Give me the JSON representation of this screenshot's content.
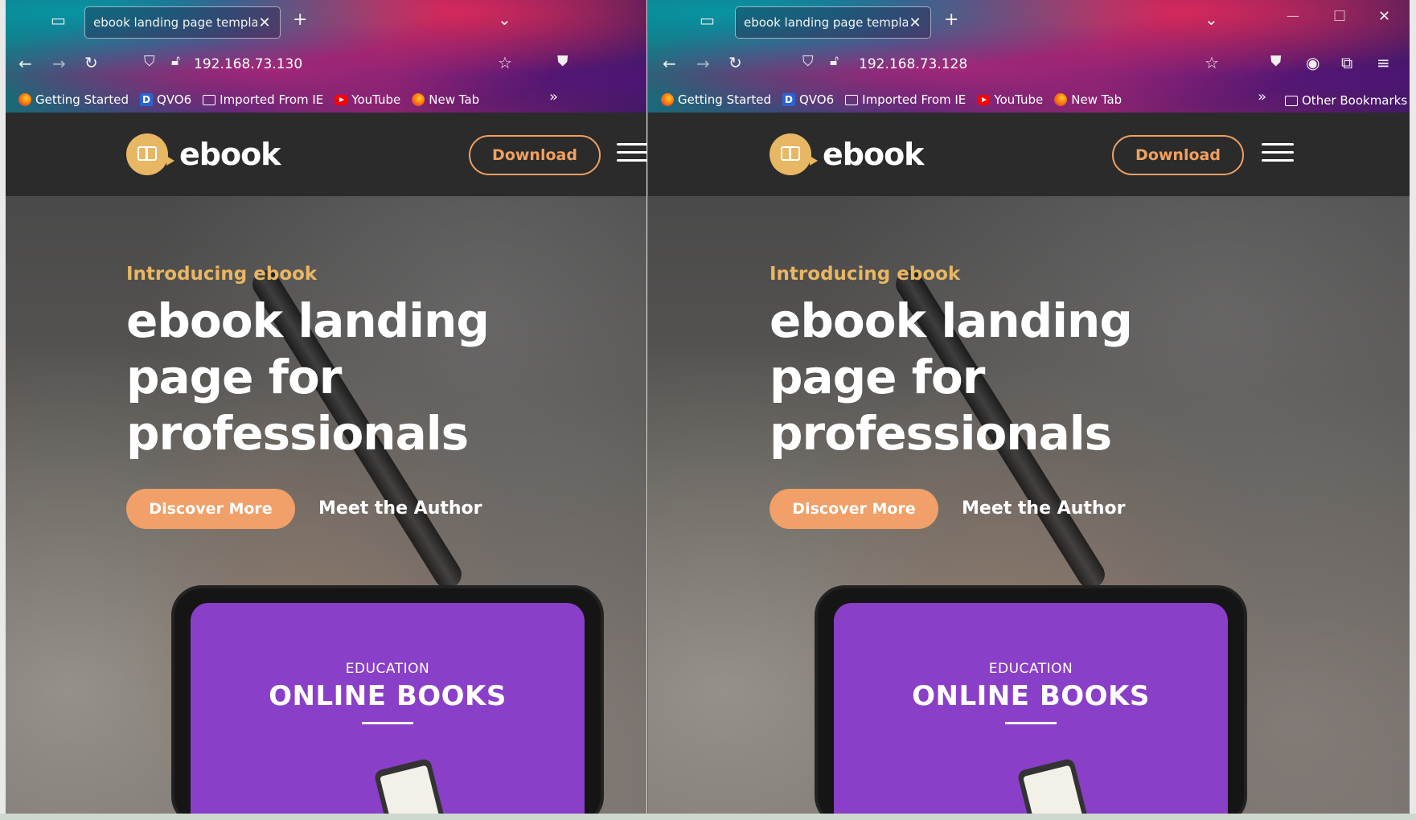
{
  "browsers": [
    {
      "tab_title": "ebook landing page template",
      "url": "192.168.73.130",
      "bookmarks": [
        "Getting Started",
        "QVO6",
        "Imported From IE",
        "YouTube",
        "New Tab"
      ]
    },
    {
      "tab_title": "ebook landing page template",
      "url": "192.168.73.128",
      "bookmarks": [
        "Getting Started",
        "QVO6",
        "Imported From IE",
        "YouTube",
        "New Tab"
      ],
      "other_bookmarks": "Other Bookmarks"
    }
  ],
  "site": {
    "logo_text": "ebook",
    "download_label": "Download",
    "intro": "Introducing ebook",
    "headline": "ebook landing\npage for\nprofessionals",
    "cta_label": "Discover More",
    "author_link": "Meet the Author",
    "tablet": {
      "category": "EDUCATION",
      "title": "ONLINE BOOKS"
    }
  },
  "colors": {
    "accent": "#f0a068",
    "gold": "#e8b763",
    "header_bg": "#2b2b2b",
    "tablet_screen": "#8a3fc8"
  },
  "icons": {
    "tab_overview": "tab-overview-icon",
    "new_tab": "plus-icon",
    "list_all_tabs": "chevron-down-icon",
    "back": "arrow-left-icon",
    "forward": "arrow-right-icon",
    "reload": "reload-icon",
    "shield": "shield-icon",
    "lock": "lock-icon",
    "bookmark_star": "star-icon",
    "pocket": "pocket-icon",
    "account": "account-icon",
    "extensions": "puzzle-icon",
    "menu": "hamburger-menu-icon"
  }
}
